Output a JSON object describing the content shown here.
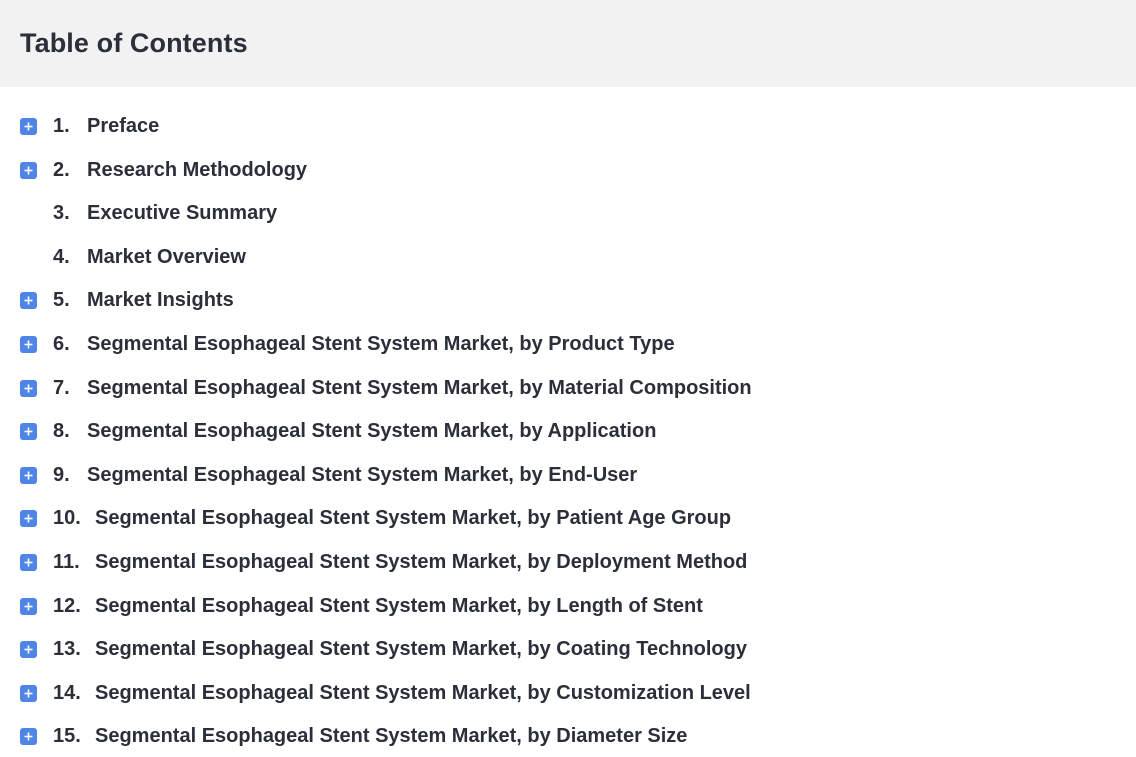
{
  "header": {
    "title": "Table of Contents"
  },
  "colors": {
    "header_bg": "#f2f2f2",
    "expand_icon": "#4f86e6",
    "text": "#2b2f3a"
  },
  "toc": {
    "items": [
      {
        "number": "1.",
        "label": "Preface",
        "expandable": true,
        "icon": "plus-icon"
      },
      {
        "number": "2.",
        "label": "Research Methodology",
        "expandable": true,
        "icon": "plus-icon"
      },
      {
        "number": "3.",
        "label": "Executive Summary",
        "expandable": false
      },
      {
        "number": "4.",
        "label": "Market Overview",
        "expandable": false
      },
      {
        "number": "5.",
        "label": "Market Insights",
        "expandable": true,
        "icon": "plus-icon"
      },
      {
        "number": "6.",
        "label": "Segmental Esophageal Stent System Market, by Product Type",
        "expandable": true,
        "icon": "plus-icon"
      },
      {
        "number": "7.",
        "label": "Segmental Esophageal Stent System Market, by Material Composition",
        "expandable": true,
        "icon": "plus-icon"
      },
      {
        "number": "8.",
        "label": "Segmental Esophageal Stent System Market, by Application",
        "expandable": true,
        "icon": "plus-icon"
      },
      {
        "number": "9.",
        "label": "Segmental Esophageal Stent System Market, by End-User",
        "expandable": true,
        "icon": "plus-icon"
      },
      {
        "number": "10.",
        "label": "Segmental Esophageal Stent System Market, by Patient Age Group",
        "expandable": true,
        "icon": "plus-icon"
      },
      {
        "number": "11.",
        "label": "Segmental Esophageal Stent System Market, by Deployment Method",
        "expandable": true,
        "icon": "plus-icon"
      },
      {
        "number": "12.",
        "label": "Segmental Esophageal Stent System Market, by Length of Stent",
        "expandable": true,
        "icon": "plus-icon"
      },
      {
        "number": "13.",
        "label": "Segmental Esophageal Stent System Market, by Coating Technology",
        "expandable": true,
        "icon": "plus-icon"
      },
      {
        "number": "14.",
        "label": "Segmental Esophageal Stent System Market, by Customization Level",
        "expandable": true,
        "icon": "plus-icon"
      },
      {
        "number": "15.",
        "label": "Segmental Esophageal Stent System Market, by Diameter Size",
        "expandable": true,
        "icon": "plus-icon"
      }
    ]
  }
}
